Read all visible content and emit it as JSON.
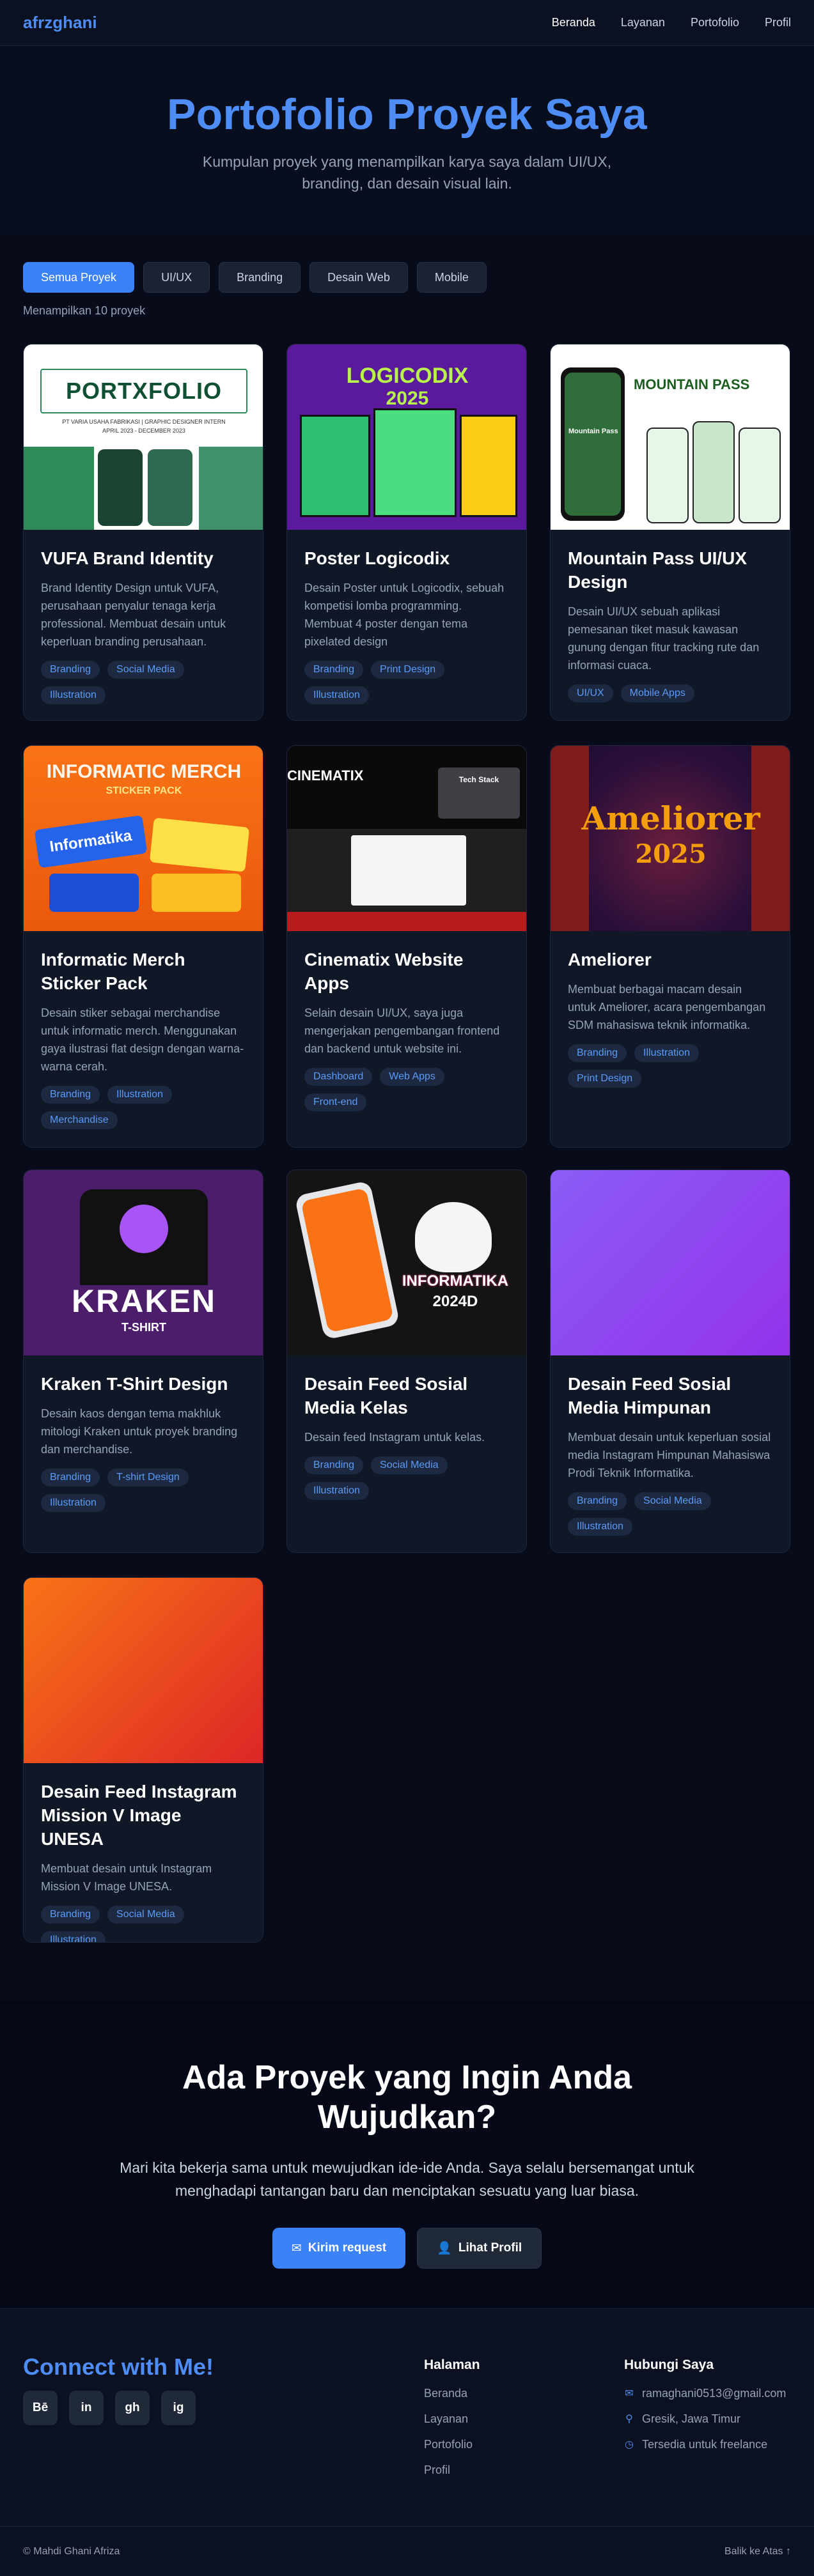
{
  "nav": {
    "brand": "afrzghani",
    "links": [
      "Beranda",
      "Layanan",
      "Portofolio",
      "Profil"
    ]
  },
  "hero": {
    "title": "Portofolio Proyek Saya",
    "subtitle": "Kumpulan proyek yang menampilkan karya saya dalam UI/UX, branding, dan desain visual lain."
  },
  "filters": [
    "Semua Proyek",
    "UI/UX",
    "Branding",
    "Desain Web",
    "Mobile"
  ],
  "count_text": "Menampilkan 10 proyek",
  "projects": [
    {
      "title": "VUFA Brand Identity",
      "desc": "Brand Identity Design untuk VUFA, perusahaan penyalur tenaga kerja professional. Membuat desain untuk keperluan branding perusahaan.",
      "tags": [
        "Branding",
        "Social Media",
        "Illustration"
      ],
      "thumb": {
        "heading": "PORTXFOLIO",
        "line1": "PT VARIA USAHA FABRIKASI  |  GRAPHIC DESIGNER INTERN",
        "line2": "APRIL 2023 - DECEMBER 2023"
      }
    },
    {
      "title": "Poster Logicodix",
      "desc": "Desain Poster untuk Logicodix, sebuah kompetisi lomba programming. Membuat 4 poster dengan tema pixelated design",
      "tags": [
        "Branding",
        "Print Design",
        "Illustration"
      ],
      "thumb": {
        "heading": "LOGICODIX",
        "line1": "2025"
      }
    },
    {
      "title": "Mountain Pass UI/UX Design",
      "desc": "Desain UI/UX sebuah aplikasi pemesanan tiket masuk kawasan gunung dengan fitur tracking rute dan informasi cuaca.",
      "tags": [
        "UI/UX",
        "Mobile Apps"
      ],
      "thumb": {
        "heading": "MOUNTAIN PASS",
        "line1": "Mountain Pass"
      }
    },
    {
      "title": "Informatic Merch Sticker Pack",
      "desc": "Desain stiker sebagai merchandise untuk informatic merch. Menggunakan gaya ilustrasi flat design dengan warna-warna cerah.",
      "tags": [
        "Branding",
        "Illustration",
        "Merchandise"
      ],
      "thumb": {
        "heading": "INFORMATIC MERCH",
        "line1": "STICKER PACK",
        "line2": "Informatika"
      }
    },
    {
      "title": "Cinematix Website Apps",
      "desc": "Selain desain UI/UX, saya juga mengerjakan pengembangan frontend dan backend untuk website ini.",
      "tags": [
        "Dashboard",
        "Web Apps",
        "Front-end"
      ],
      "thumb": {
        "heading": "CINEMATIX",
        "line1": "Tech Stack"
      }
    },
    {
      "title": "Ameliorer",
      "desc": "Membuat berbagai macam desain untuk Ameliorer, acara pengembangan SDM mahasiswa teknik informatika.",
      "tags": [
        "Branding",
        "Illustration",
        "Print Design"
      ],
      "thumb": {
        "heading": "Ameliorer",
        "line1": "2025"
      }
    },
    {
      "title": "Kraken T-Shirt Design",
      "desc": "Desain kaos dengan tema makhluk mitologi Kraken untuk proyek branding dan merchandise.",
      "tags": [
        "Branding",
        "T-shirt Design",
        "Illustration"
      ],
      "thumb": {
        "heading": "KRAKEN",
        "line1": "T-SHIRT"
      }
    },
    {
      "title": "Desain Feed Sosial Media Kelas",
      "desc": "Desain feed Instagram untuk kelas.",
      "tags": [
        "Branding",
        "Social Media",
        "Illustration"
      ],
      "thumb": {
        "heading": "INFORMATIKA",
        "line1": "2024D"
      }
    },
    {
      "title": "Desain Feed Sosial Media Himpunan",
      "desc": "Membuat desain untuk keperluan sosial media Instagram Himpunan Mahasiswa Prodi Teknik Informatika.",
      "tags": [
        "Branding",
        "Social Media",
        "Illustration"
      ],
      "thumb": {
        "heading": "",
        "line1": ""
      }
    },
    {
      "title": "Desain Feed Instagram Mission V Image UNESA",
      "desc": "Membuat desain untuk Instagram Mission V Image UNESA.",
      "tags": [
        "Branding",
        "Social Media",
        "Illustration"
      ],
      "thumb": {
        "heading": "",
        "line1": ""
      }
    }
  ],
  "cta": {
    "title": "Ada Proyek yang Ingin Anda Wujudkan?",
    "text": "Mari kita bekerja sama untuk mewujudkan ide-ide Anda. Saya selalu bersemangat untuk menghadapi tantangan baru dan menciptakan sesuatu yang luar biasa.",
    "primary": "Kirim request",
    "secondary": "Lihat Profil"
  },
  "footer": {
    "connect": "Connect with Me!",
    "socials": [
      "Bē",
      "in",
      "gh",
      "ig"
    ],
    "pages_title": "Halaman",
    "pages": [
      "Beranda",
      "Layanan",
      "Portofolio",
      "Profil"
    ],
    "contact_title": "Hubungi Saya",
    "contact": [
      "ramaghani0513@gmail.com",
      "Gresik, Jawa Timur",
      "Tersedia untuk freelance"
    ],
    "copyright": "© Mahdi Ghani Afriza",
    "back_to_top": "Balik ke Atas ↑"
  },
  "colors": {
    "accent": "#3b82f6",
    "tag_text": "#5b9bf8",
    "bg": "#070b1a",
    "card": "#101828"
  }
}
